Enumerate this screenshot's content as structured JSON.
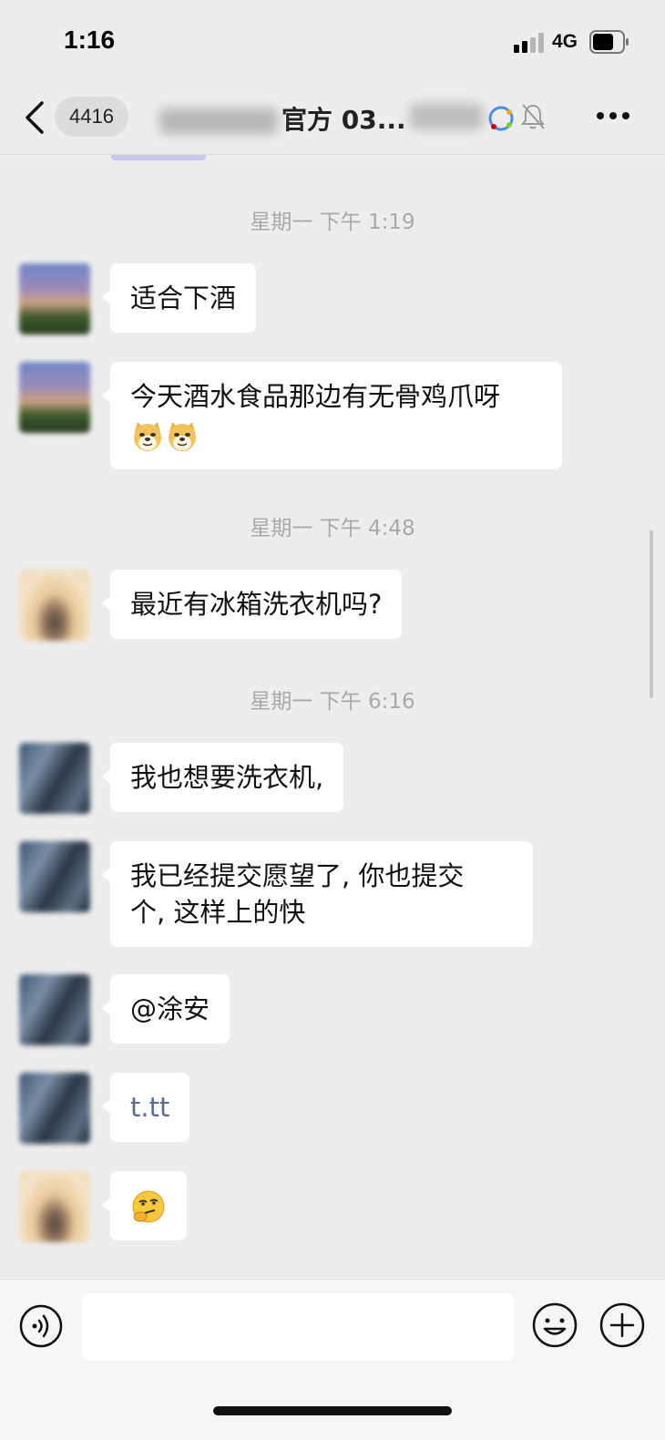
{
  "status_bar": {
    "time": "1:16",
    "network": "4G",
    "icons": [
      "signal-icon",
      "battery-icon"
    ]
  },
  "nav": {
    "back_icon": "chevron-left-icon",
    "unread_count": "4416",
    "title_visible": "官方 03...",
    "icons": [
      "official-account-icon",
      "mute-bell-icon",
      "more-icon"
    ]
  },
  "messages": [
    {
      "type": "timestamp",
      "text": "星期一 下午 1:19"
    },
    {
      "type": "message",
      "avatar": "landscape",
      "text": "适合下酒"
    },
    {
      "type": "message",
      "avatar": "landscape",
      "text": "今天酒水食品那边有无骨鸡爪呀",
      "emoji": [
        "doge-emoji",
        "doge-emoji"
      ]
    },
    {
      "type": "timestamp",
      "text": "星期一 下午 4:48"
    },
    {
      "type": "message",
      "avatar": "sunset",
      "text": "最近有冰箱洗衣机吗?"
    },
    {
      "type": "timestamp",
      "text": "星期一 下午 6:16"
    },
    {
      "type": "message",
      "avatar": "dark",
      "text": "我也想要洗衣机,"
    },
    {
      "type": "message",
      "avatar": "dark",
      "text_lines": [
        "我已经提交愿望了, 你也提交",
        "个, 这样上的快"
      ]
    },
    {
      "type": "message",
      "avatar": "dark",
      "text": "@涂安"
    },
    {
      "type": "message",
      "avatar": "dark",
      "link_text": "t.tt"
    },
    {
      "type": "message",
      "avatar": "sunset",
      "emoji": [
        "thinking-smirk-emoji"
      ]
    }
  ],
  "input_bar": {
    "placeholder": "",
    "value": "",
    "icons": [
      "voice-icon",
      "emoji-icon",
      "plus-icon"
    ]
  },
  "colors": {
    "background": "#ededed",
    "bubble": "#ffffff",
    "timestamp": "#a9a9a9",
    "link": "#576b95"
  }
}
